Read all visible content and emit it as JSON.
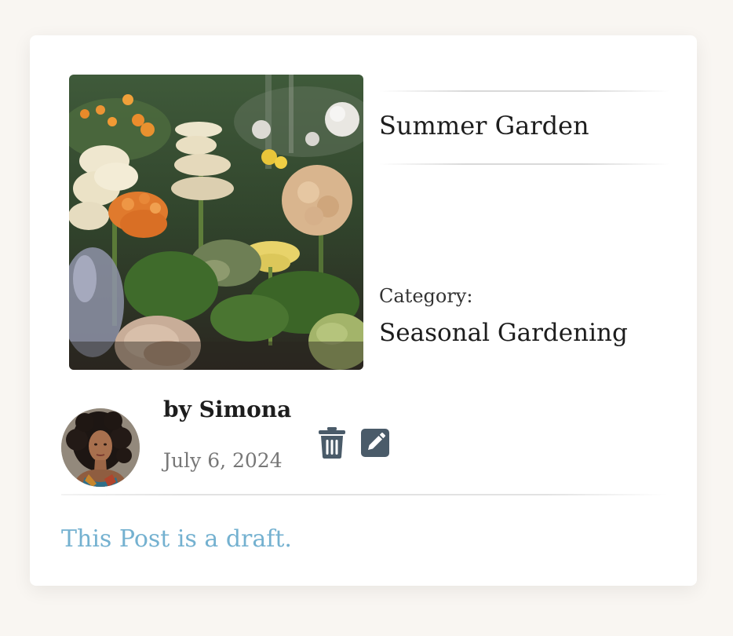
{
  "post": {
    "title": "Summer Garden",
    "category_label": "Category:",
    "category": "Seasonal Gardening",
    "author": "by Simona",
    "date": "July 6, 2024",
    "status_message": "This Post is a draft."
  },
  "icons": {
    "delete": "trash-icon",
    "edit": "pencil-icon"
  },
  "colors": {
    "icon": "#4a5b69",
    "draft_text": "#74b1d0",
    "background": "#f9f6f2"
  }
}
